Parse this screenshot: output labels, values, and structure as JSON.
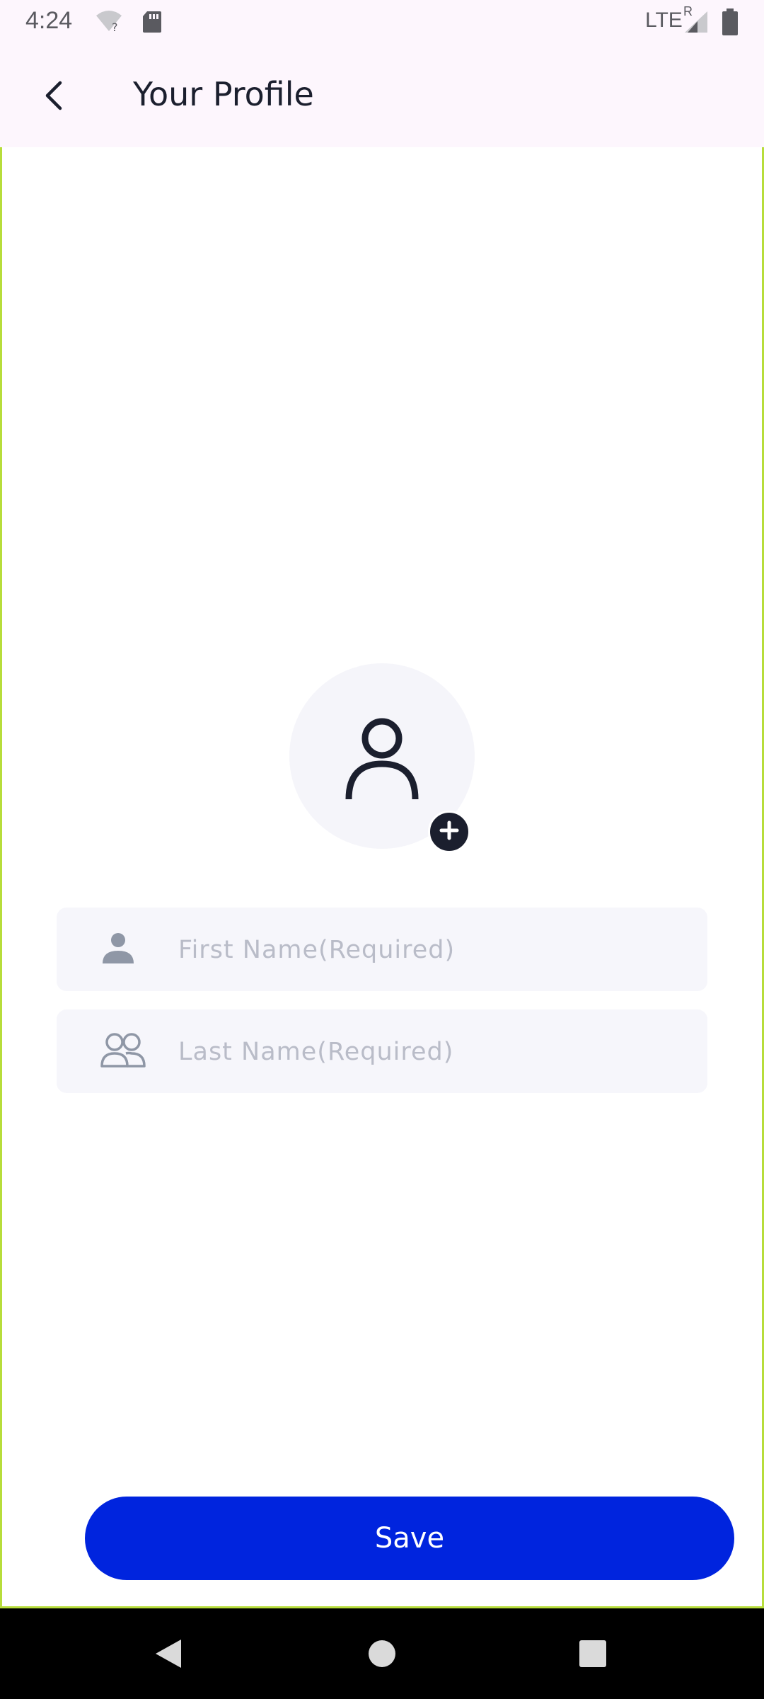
{
  "status_bar": {
    "time": "4:24",
    "network": "LTE",
    "roaming": "R",
    "icons": [
      "wifi-icon",
      "sd-card-icon",
      "signal-icon",
      "battery-icon"
    ]
  },
  "app_bar": {
    "title": "Your Profile",
    "back_icon": "chevron-left-icon"
  },
  "avatar": {
    "icon": "person-icon",
    "add_icon": "plus-icon"
  },
  "form": {
    "first_name": {
      "placeholder": "First Name(Required)",
      "value": "",
      "icon": "person-icon"
    },
    "last_name": {
      "placeholder": "Last Name(Required)",
      "value": "",
      "icon": "people-icon"
    }
  },
  "actions": {
    "save_label": "Save"
  },
  "colors": {
    "primary": "#0024de",
    "app_bar_bg": "#fdf6fd",
    "field_bg": "#f6f6fb",
    "dark": "#1b1f2e"
  }
}
